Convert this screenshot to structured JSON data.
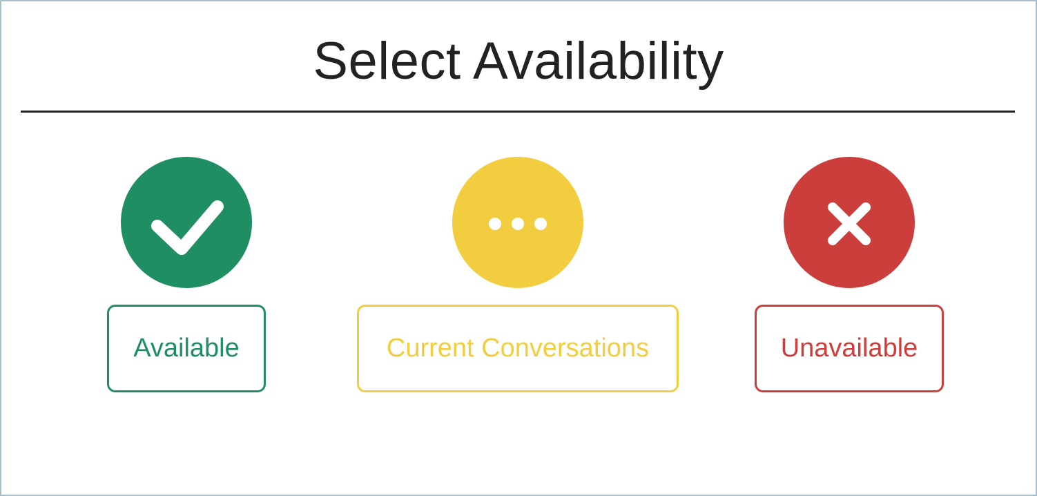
{
  "page": {
    "title": "Select Availability"
  },
  "options": [
    {
      "id": "available",
      "label": "Available",
      "icon": "check-icon",
      "color": "#208e63"
    },
    {
      "id": "current",
      "label": "Current Conversations",
      "icon": "ellipsis-icon",
      "color": "#f2cd3f"
    },
    {
      "id": "unavailable",
      "label": "Unavailable",
      "icon": "close-icon",
      "color": "#cc3e3c"
    }
  ]
}
